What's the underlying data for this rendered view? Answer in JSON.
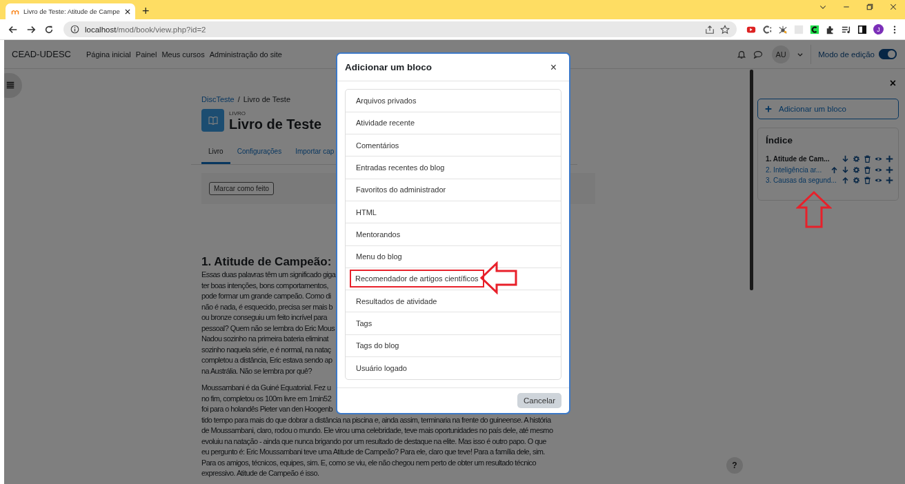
{
  "browser": {
    "tab": {
      "title": "Livro de Teste: Atitude de Campe",
      "selected": true
    },
    "new_tab": "+",
    "url": {
      "host": "localhost",
      "path": "/mod/book/view.php?id=2"
    },
    "profile": "J"
  },
  "navbar": {
    "brand": "CEAD-UDESC",
    "links": [
      "Página inicial",
      "Painel",
      "Meus cursos",
      "Administração do site"
    ],
    "avatar": "AU",
    "edit_mode": {
      "label": "Modo de edição",
      "on": true
    }
  },
  "page": {
    "breadcrumb": [
      "DiscTeste",
      "Livro de Teste"
    ],
    "breadcrumb_separator": "/",
    "module_type": "LIVRO",
    "title": "Livro de Teste",
    "tabs": [
      {
        "label": "Livro",
        "selected": true
      },
      {
        "label": "Configurações",
        "selected": false
      },
      {
        "label": "Importar cap",
        "selected": false
      }
    ],
    "completion_button": "Marcar como feito",
    "chapter_title": "1. Atitude de Campeão:",
    "paragraphs": [
      [
        "Essas duas palavras têm um significado giga",
        "ter boas intenções, bons comportamentos,",
        "pode formar um grande campeão. Como di",
        "não é nada, é esquecido, precisa ser mais b",
        "ou bronze conseguiu um feito incrível para",
        "pessoal? Quem não se lembra do Eric Mous",
        "Nadou sozinho na primeira bateria eliminat",
        "sozinho naquela série, e é normal, na nataç",
        "completou a distância, Eric estava sendo ap",
        "na Austrália. Não se lembra por quê?"
      ],
      [
        "Moussambani é da Guiné Equatorial. Fez u",
        "no fim, completou os 100m livre em 1min52",
        "foi para o holandês Pieter van den Hoogenb",
        "tido tempo para mais do que dobrar a distância na piscina e, ainda assim, terminaria na frente do guineense. A história",
        "de Moussambani, claro, rodou o mundo. Ele virou uma celebridade, teve mais oportunidades no país dele, até mesmo",
        "evoluiu na natação - ainda que nunca brigando por um resultado de destaque na elite. Mas isso é outro papo. O que",
        "eu pergunto é: Eric Moussambani teve uma Atitude de Campeão? Para ele, claro que teve! Para a família dele, sim.",
        "Para os amigos, técnicos, equipes, sim. E, como se viu, ele não chegou nem perto de obter um resultado técnico",
        "expressivo. Atitude de Campeão é isso."
      ]
    ]
  },
  "help_button": "?",
  "block_drawer": {
    "close": "×",
    "add_block": "Adicionar um bloco",
    "toc": {
      "title": "Índice",
      "chapters": [
        {
          "title": "1. Atitude de Cam...",
          "current": true,
          "actions": [
            {
              "kind": "down"
            },
            {
              "kind": "settings"
            },
            {
              "kind": "delete"
            },
            {
              "kind": "hide"
            },
            {
              "kind": "add"
            }
          ]
        },
        {
          "title": "2. Inteligência ar...",
          "current": false,
          "actions": [
            {
              "kind": "up"
            },
            {
              "kind": "down"
            },
            {
              "kind": "settings"
            },
            {
              "kind": "delete"
            },
            {
              "kind": "hide"
            },
            {
              "kind": "add"
            }
          ]
        },
        {
          "title": "3. Causas da segund...",
          "current": false,
          "actions": [
            {
              "kind": "up"
            },
            {
              "kind": "settings"
            },
            {
              "kind": "delete"
            },
            {
              "kind": "hide"
            },
            {
              "kind": "add"
            }
          ]
        }
      ]
    }
  },
  "modal": {
    "title": "Adicionar um bloco",
    "close": "×",
    "items": [
      {
        "label": "Arquivos privados",
        "highlighted": false
      },
      {
        "label": "Atividade recente",
        "highlighted": false
      },
      {
        "label": "Comentários",
        "highlighted": false
      },
      {
        "label": "Entradas recentes do blog",
        "highlighted": false
      },
      {
        "label": "Favoritos do administrador",
        "highlighted": false
      },
      {
        "label": "HTML",
        "highlighted": false
      },
      {
        "label": "Mentorandos",
        "highlighted": false
      },
      {
        "label": "Menu do blog",
        "highlighted": false
      },
      {
        "label": "Recomendador de artigos científicos",
        "highlighted": true
      },
      {
        "label": "Resultados de atividade",
        "highlighted": false
      },
      {
        "label": "Tags",
        "highlighted": false
      },
      {
        "label": "Tags do blog",
        "highlighted": false
      },
      {
        "label": "Usuário logado",
        "highlighted": false
      }
    ],
    "cancel": "Cancelar"
  },
  "annotations": [
    {
      "kind": "arrow-left"
    },
    {
      "kind": "arrow-up"
    }
  ]
}
